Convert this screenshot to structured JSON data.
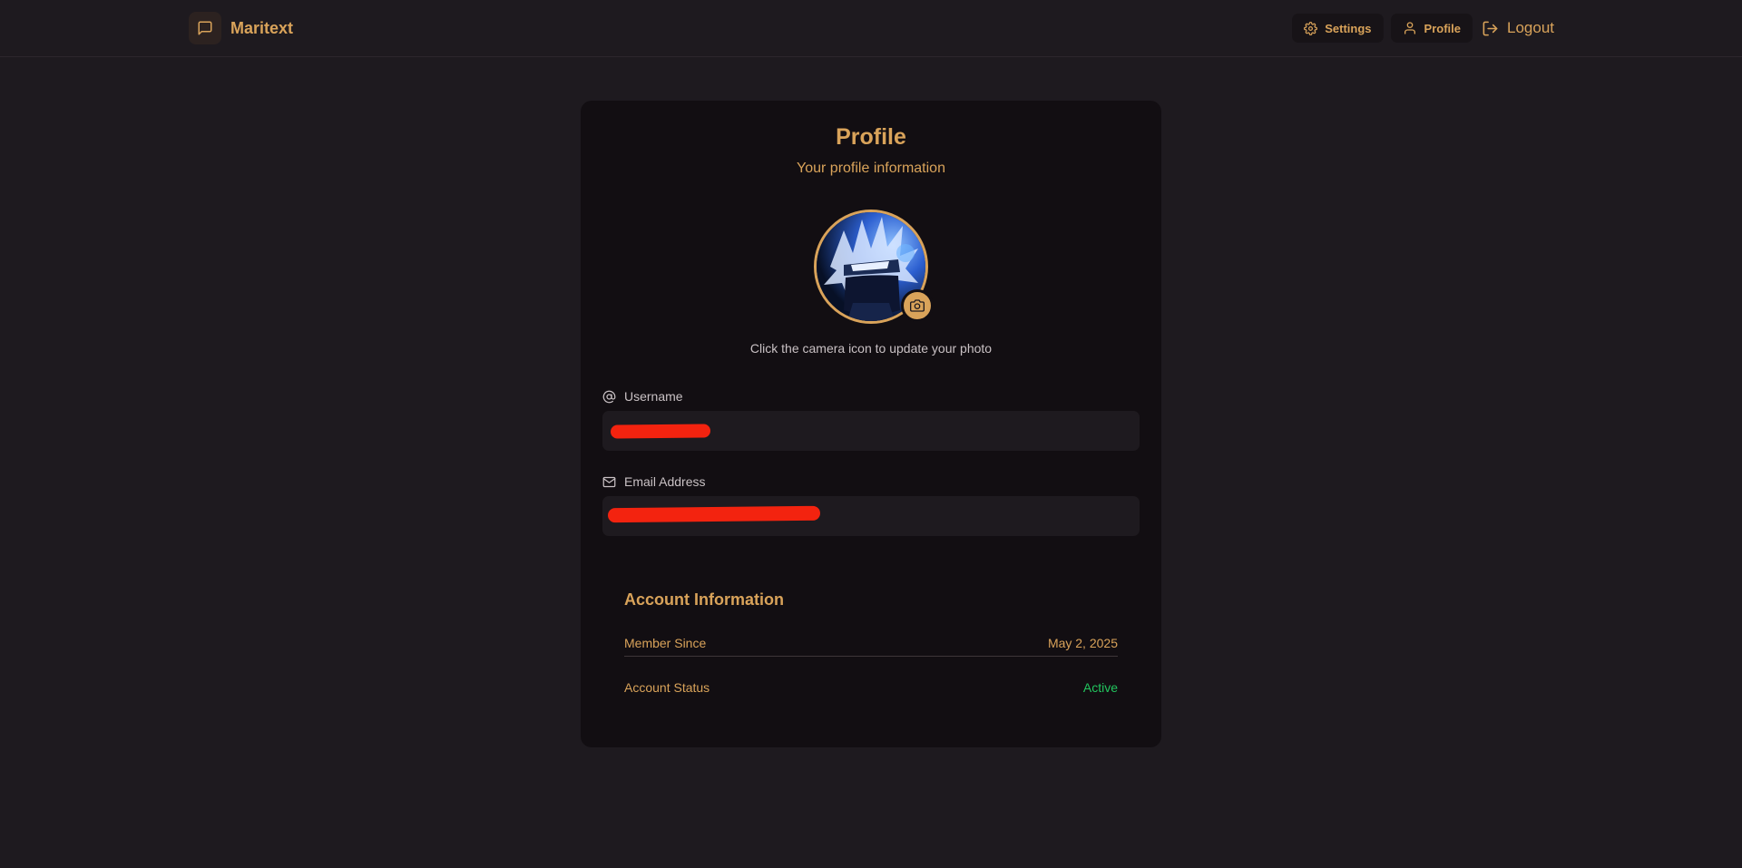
{
  "header": {
    "brand_name": "Maritext",
    "nav": {
      "settings_label": "Settings",
      "profile_label": "Profile",
      "logout_label": "Logout"
    }
  },
  "profile": {
    "title": "Profile",
    "subtitle": "Your profile information",
    "avatar_hint": "Click the camera icon to update your photo",
    "username": {
      "label": "Username",
      "value": ""
    },
    "email": {
      "label": "Email Address",
      "value": ""
    }
  },
  "account": {
    "title": "Account Information",
    "rows": [
      {
        "key": "Member Since",
        "value": "May 2, 2025"
      },
      {
        "key": "Account Status",
        "value": "Active"
      }
    ]
  },
  "colors": {
    "accent": "#d9a35a",
    "background": "#1e1a1f",
    "card": "#120e12",
    "status_active": "#22c55e",
    "redaction": "#f3230f"
  },
  "icons": {
    "brand": "message-square-icon",
    "settings": "gear-icon",
    "profile": "user-icon",
    "logout": "logout-icon",
    "camera": "camera-icon",
    "username": "at-sign-icon",
    "email": "mail-icon"
  }
}
